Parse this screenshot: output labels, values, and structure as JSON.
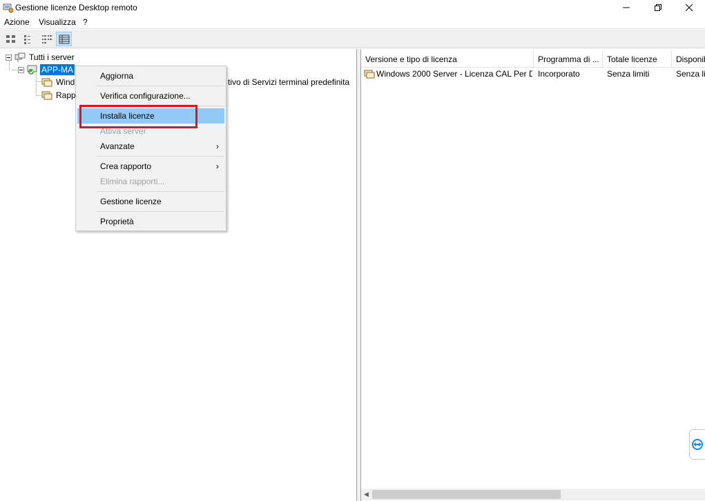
{
  "window": {
    "title": "Gestione licenze Desktop remoto"
  },
  "menubar": {
    "items": [
      "Azione",
      "Visualizza",
      "?"
    ]
  },
  "tree": {
    "root_label": "Tutti i server",
    "server_label": "APP-MA",
    "child1_label": "Wind",
    "child1_trailing_text": "tivo di Servizi terminal predefinita",
    "child2_label": "Rapp"
  },
  "list": {
    "columns": [
      "Versione e tipo di licenza",
      "Programma di ...",
      "Totale licenze",
      "Disponib"
    ],
    "rows": [
      {
        "version": "Windows 2000 Server - Licenza CAL Per D...",
        "program": "Incorporato",
        "total": "Senza limiti",
        "available": "Senza lim"
      }
    ]
  },
  "context_menu": {
    "aggiorna": "Aggiorna",
    "verifica": "Verifica configurazione...",
    "installa": "Installa licenze",
    "attiva": "Attiva server",
    "avanzate": "Avanzate",
    "crea_rapporto": "Crea rapporto",
    "elimina_rapporti": "Elimina rapporti...",
    "gestione": "Gestione licenze",
    "proprieta": "Proprietà",
    "submenu_glyph": "›"
  },
  "colors": {
    "highlight": "#91c9f7",
    "selection": "#0078d7",
    "annotation_red": "#e0121f"
  }
}
